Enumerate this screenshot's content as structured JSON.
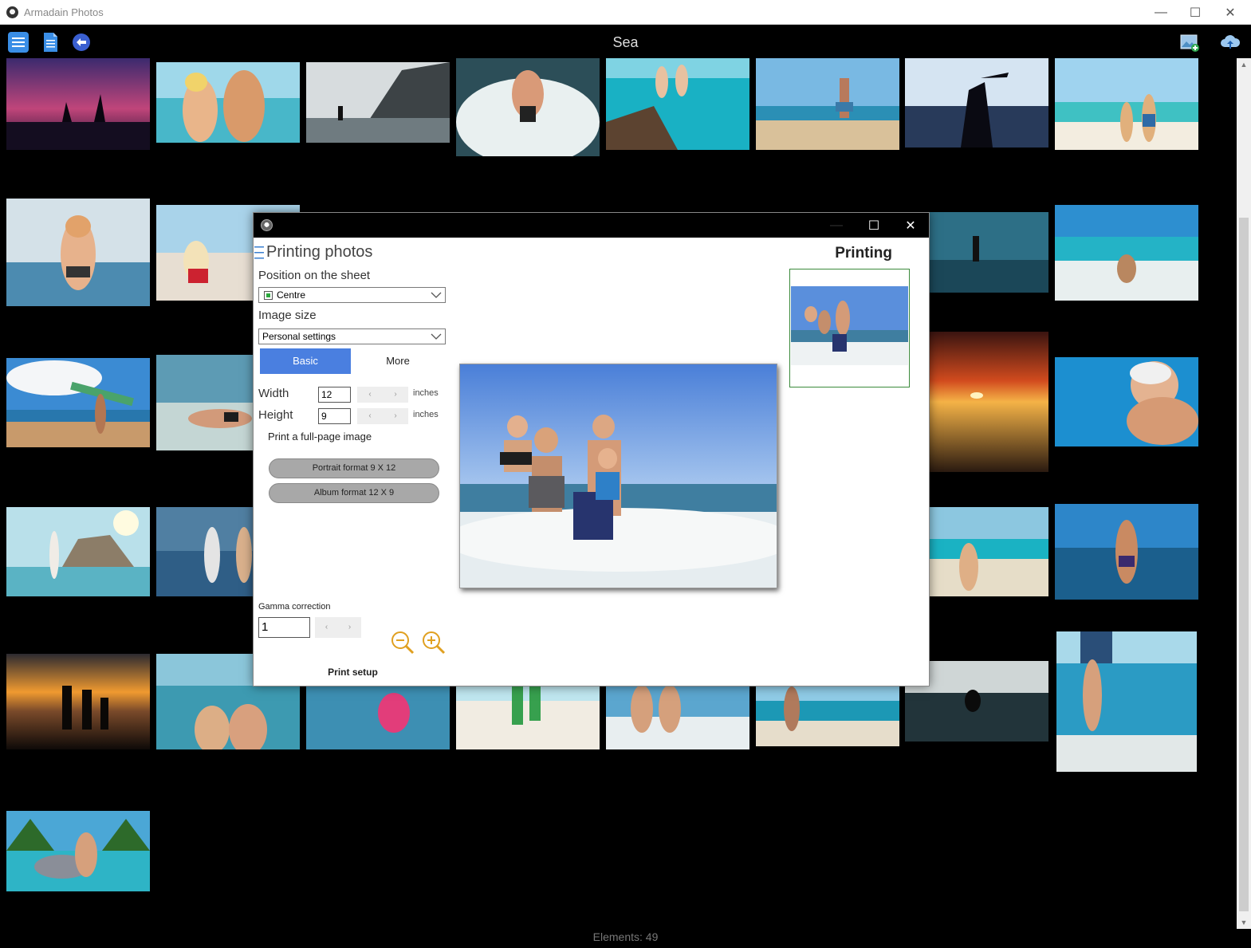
{
  "app": {
    "title": "Armadain Photos",
    "album_title": "Sea",
    "status": "Elements: 49"
  },
  "window_controls": {
    "minimize": "—",
    "maximize": "☐",
    "close": "✕"
  },
  "toolbar_icons": [
    "menu-icon",
    "document-icon",
    "back-arrow-icon",
    "add-image-icon",
    "cloud-upload-icon"
  ],
  "dialog": {
    "heading": "Printing photos",
    "panel_title": "Printing",
    "position_label": "Position on the sheet",
    "position_value": "Centre",
    "image_size_label": "Image size",
    "image_size_value": "Personal settings",
    "tabs": [
      {
        "label": "Basic",
        "active": true
      },
      {
        "label": "More",
        "active": false
      }
    ],
    "width_label": "Width",
    "width_value": "12",
    "height_label": "Height",
    "height_value": "9",
    "unit": "inches",
    "full_page_label": "Print a full-page image",
    "portrait_button": "Portrait format 9 X 12",
    "album_button": "Album format 12 X 9",
    "gamma_label": "Gamma correction",
    "gamma_value": "1",
    "print_setup": "Print setup",
    "spin_prev": "‹",
    "spin_next": "›",
    "accent_color": "#4a7fe0",
    "zoom_icons": [
      "zoom-out-icon",
      "zoom-in-icon"
    ]
  }
}
